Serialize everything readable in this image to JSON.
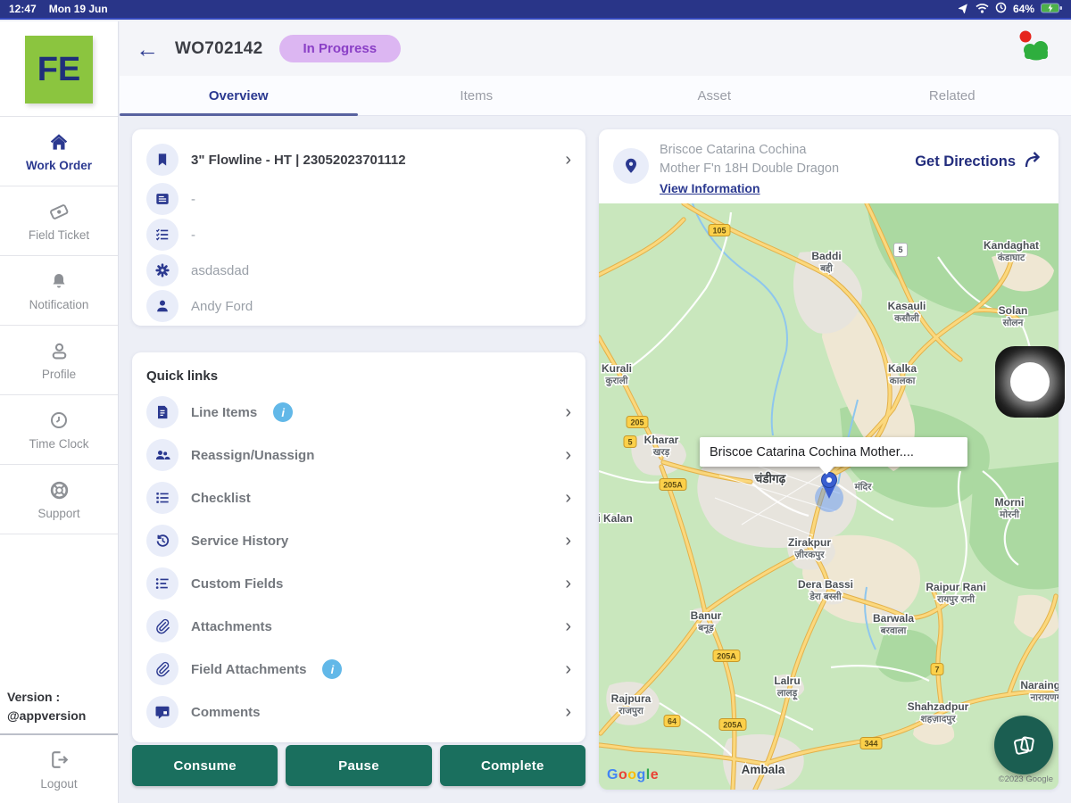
{
  "status_bar": {
    "time": "12:47",
    "date": "Mon 19 Jun",
    "battery_percent": "64%"
  },
  "header": {
    "work_order_id": "WO702142",
    "status_badge": "In Progress"
  },
  "tabs": {
    "overview": "Overview",
    "items": "Items",
    "asset": "Asset",
    "related": "Related"
  },
  "sidebar": {
    "logo_text": "FE",
    "items": [
      {
        "label": "Work Order",
        "icon": "home-icon",
        "active": true
      },
      {
        "label": "Field Ticket",
        "icon": "ticket-icon",
        "active": false
      },
      {
        "label": "Notification",
        "icon": "bell-icon",
        "active": false
      },
      {
        "label": "Profile",
        "icon": "person-icon",
        "active": false
      },
      {
        "label": "Time Clock",
        "icon": "clock-icon",
        "active": false
      },
      {
        "label": "Support",
        "icon": "lifebuoy-icon",
        "active": false
      }
    ],
    "version_label": "Version :",
    "version_value": "@appversion",
    "logout_label": "Logout"
  },
  "details_card": {
    "title": "3\" Flowline - HT | 23052023701112",
    "rows": [
      {
        "icon": "card-list-icon",
        "value": "-"
      },
      {
        "icon": "task-list-icon",
        "value": "-"
      },
      {
        "icon": "gear-icon",
        "value": "asdasdad"
      },
      {
        "icon": "person-icon",
        "value": "Andy Ford"
      }
    ]
  },
  "quick_links": {
    "title": "Quick links",
    "items": [
      {
        "label": "Line Items",
        "icon": "document-icon",
        "has_info": true
      },
      {
        "label": "Reassign/Unassign",
        "icon": "people-icon",
        "has_info": false
      },
      {
        "label": "Checklist",
        "icon": "checklist-icon",
        "has_info": false
      },
      {
        "label": "Service History",
        "icon": "history-icon",
        "has_info": false
      },
      {
        "label": "Custom Fields",
        "icon": "list-icon",
        "has_info": false
      },
      {
        "label": "Attachments",
        "icon": "paperclip-icon",
        "has_info": false
      },
      {
        "label": "Field Attachments",
        "icon": "paperclip-icon",
        "has_info": true
      },
      {
        "label": "Comments",
        "icon": "comment-icon",
        "has_info": false
      }
    ]
  },
  "action_buttons": {
    "consume": "Consume",
    "pause": "Pause",
    "complete": "Complete"
  },
  "location_panel": {
    "address_line1": "Briscoe Catarina Cochina",
    "address_line2": "Mother F'n 18H Double Dragon",
    "view_information": "View Information",
    "get_directions": "Get Directions"
  },
  "map": {
    "marker_tooltip": "Briscoe Catarina Cochina Mother....",
    "attribution": "©2023 Google",
    "logo_letters": [
      "G",
      "o",
      "o",
      "g",
      "l",
      "e"
    ],
    "towns": [
      {
        "name": "Baddi",
        "hindi": "बद्दी"
      },
      {
        "name": "Kandaghat",
        "hindi": "कंडाघाट"
      },
      {
        "name": "Kasauli",
        "hindi": "कसौली"
      },
      {
        "name": "Solan",
        "hindi": "सोलन"
      },
      {
        "name": "Kalka",
        "hindi": "कालका"
      },
      {
        "name": "Kurali",
        "hindi": "कुराली"
      },
      {
        "name": "Kharar",
        "hindi": "खरड़"
      },
      {
        "name": "चंडीगढ़",
        "hindi": ""
      },
      {
        "name": "मंदिर",
        "hindi": ""
      },
      {
        "name": "Morni",
        "hindi": "मोरनी"
      },
      {
        "name": "i Kalan",
        "hindi": ""
      },
      {
        "name": "Zirakpur",
        "hindi": "ज़ीरकपुर"
      },
      {
        "name": "Dera Bassi",
        "hindi": "डेरा बस्सी"
      },
      {
        "name": "Banur",
        "hindi": "बनूड़"
      },
      {
        "name": "Raipur Rani",
        "hindi": "रायपुर रानी"
      },
      {
        "name": "Barwala",
        "hindi": "बरवाला"
      },
      {
        "name": "Lalru",
        "hindi": "लालड़ू"
      },
      {
        "name": "Rajpura",
        "hindi": "राजपुरा"
      },
      {
        "name": "Shahzadpur",
        "hindi": "शहज़ादपुर"
      },
      {
        "name": "Naraingarh",
        "hindi": "नारायणगढ़"
      },
      {
        "name": "Ambala",
        "hindi": ""
      }
    ],
    "route_shields": [
      "105",
      "5",
      "205",
      "5",
      "205A",
      "205A",
      "205A",
      "344",
      "7",
      "64"
    ]
  },
  "colors": {
    "primary_navy": "#2b3990",
    "status_bar_blue": "#293588",
    "badge_bg": "#dcb6f2",
    "badge_text": "#8a3fc6",
    "action_button_green": "#1a6f5e",
    "info_blue": "#62b8e8",
    "logo_green": "#8bc53f",
    "map_land_green": "#c9e7bd",
    "fab_green": "#1b5e51",
    "alert_red": "#e6251d",
    "cloud_icon_green": "#2fae3e"
  }
}
